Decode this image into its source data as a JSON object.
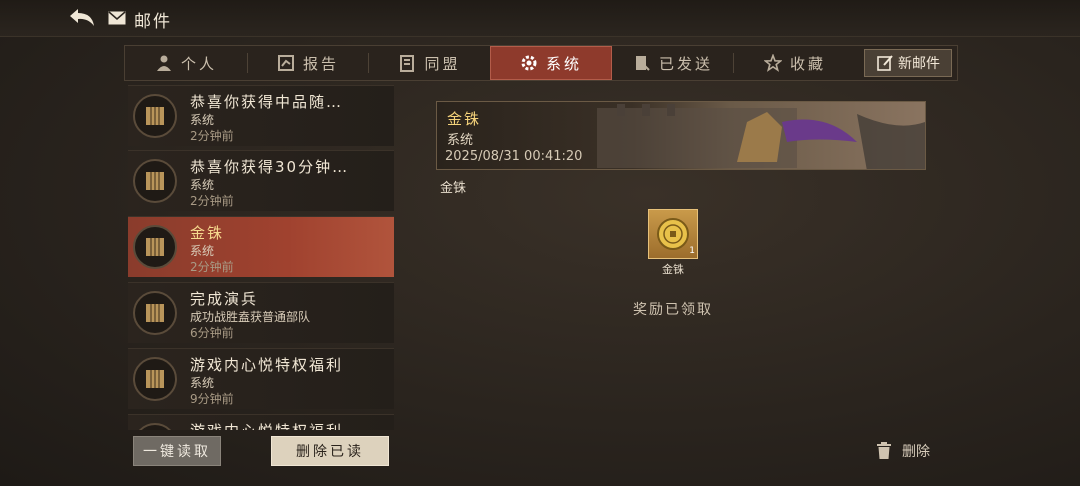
{
  "header": {
    "title": "邮件",
    "back_icon": "back-arrow-icon",
    "mail_icon": "envelope-icon"
  },
  "tabs": [
    {
      "label": "个人",
      "icon": "person-icon"
    },
    {
      "label": "报告",
      "icon": "report-icon"
    },
    {
      "label": "同盟",
      "icon": "alliance-icon"
    },
    {
      "label": "系统",
      "icon": "gear-icon",
      "active": true
    },
    {
      "label": "已发送",
      "icon": "sent-icon"
    },
    {
      "label": "收藏",
      "icon": "star-icon"
    }
  ],
  "new_mail_label": "新邮件",
  "mail_list": [
    {
      "title": "恭喜你获得中品随…",
      "sender": "系统",
      "time": "2分钟前"
    },
    {
      "title": "恭喜你获得30分钟…",
      "sender": "系统",
      "time": "2分钟前"
    },
    {
      "title": "金铢",
      "sender": "系统",
      "time": "2分钟前",
      "active": true
    },
    {
      "title": "完成演兵",
      "sender": "成功战胜盍获普通部队",
      "time": "6分钟前"
    },
    {
      "title": "游戏内心悦特权福利",
      "sender": "系统",
      "time": "9分钟前"
    },
    {
      "title": "游戏内心悦特权福利",
      "sender": "",
      "time": ""
    }
  ],
  "buttons": {
    "read_all": "一键读取",
    "delete_read": "删除已读",
    "delete": "删除"
  },
  "detail": {
    "title": "金铢",
    "sender": "系统",
    "time": "2025/08/31 00:41:20",
    "body": "金铢",
    "reward": {
      "name": "金铢",
      "count": "1",
      "icon": "gold-coin-icon"
    },
    "status": "奖励已领取"
  },
  "colors": {
    "accent": "#8e3a2c",
    "gold": "#f4d27a",
    "background": "#2a241e"
  }
}
